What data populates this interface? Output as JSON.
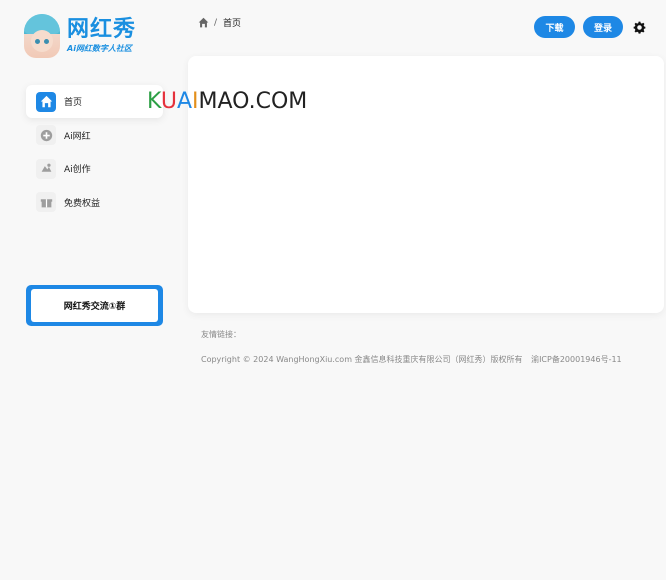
{
  "brand": {
    "name": "网红秀",
    "tagline": "Ai网红数字人社区"
  },
  "sidebar": {
    "items": [
      {
        "label": "首页",
        "icon": "home-icon",
        "active": true
      },
      {
        "label": "Ai网红",
        "icon": "plus-circle-icon",
        "active": false
      },
      {
        "label": "Ai创作",
        "icon": "creation-icon",
        "active": false
      },
      {
        "label": "免费权益",
        "icon": "gift-icon",
        "active": false
      }
    ],
    "group_button": "网红秀交流①群"
  },
  "breadcrumb": {
    "separator": "/",
    "current": "首页"
  },
  "header": {
    "download": "下载",
    "login": "登录"
  },
  "watermark": {
    "parts": [
      "K",
      "U",
      "A",
      "I",
      "MAO.COM"
    ]
  },
  "footer": {
    "friend_links": "友情链接：",
    "copyright": "Copyright © 2024 WangHongXiu.com 金鑫信息科技重庆有限公司（网红秀）版权所有",
    "icp": "渝ICP备20001946号-11"
  },
  "colors": {
    "accent": "#1e88e5",
    "background": "#f8f8f8",
    "card": "#ffffff"
  }
}
